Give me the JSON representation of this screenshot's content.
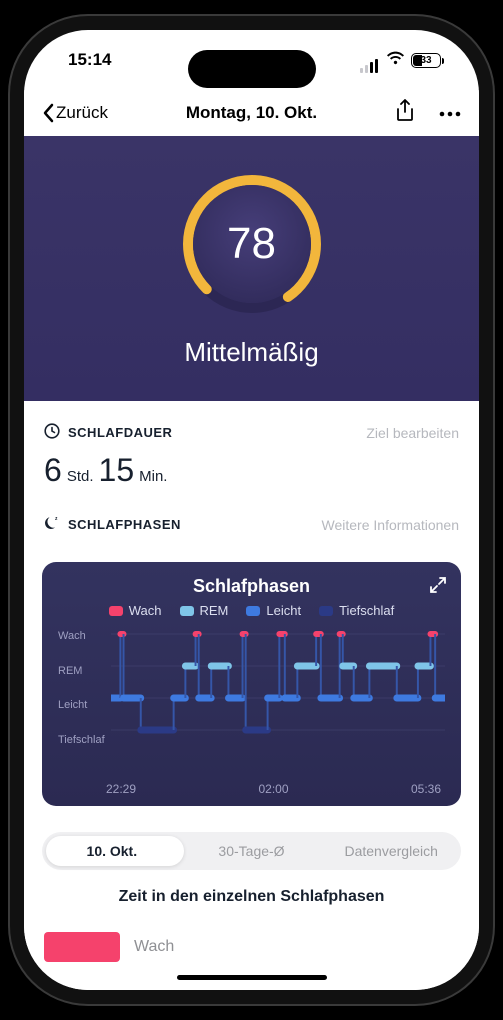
{
  "status": {
    "time": "15:14",
    "battery_pct": "33"
  },
  "nav": {
    "back": "Zurück",
    "title": "Montag, 10. Okt."
  },
  "score": {
    "value": "78",
    "rating": "Mittelmäßig",
    "pct": 78
  },
  "colors": {
    "ring": "#f2b63c",
    "wake": "#f5426c",
    "rem": "#7fc5e8",
    "light": "#3e7ae0",
    "deep": "#2b3a86"
  },
  "duration": {
    "section_title": "SCHLAFDAUER",
    "edit_goal": "Ziel bearbeiten",
    "hours": "6",
    "hours_unit": "Std.",
    "minutes": "15",
    "minutes_unit": "Min."
  },
  "phases": {
    "section_title": "SCHLAFPHASEN",
    "more_info": "Weitere Informationen",
    "chart_title": "Schlafphasen"
  },
  "chart_data": {
    "type": "line",
    "title": "Schlafphasen",
    "y_categories": [
      "Wach",
      "REM",
      "Leicht",
      "Tiefschlaf"
    ],
    "x_ticks": [
      "22:29",
      "02:00",
      "05:36"
    ],
    "x_range_minutes": [
      0,
      427
    ],
    "legend": [
      {
        "name": "Wach",
        "color": "#f5426c"
      },
      {
        "name": "REM",
        "color": "#7fc5e8"
      },
      {
        "name": "Leicht",
        "color": "#3e7ae0"
      },
      {
        "name": "Tiefschlaf",
        "color": "#2b3a86"
      }
    ],
    "segments": [
      {
        "stage": "Leicht",
        "start": 0,
        "end": 12
      },
      {
        "stage": "Wach",
        "start": 12,
        "end": 16
      },
      {
        "stage": "Leicht",
        "start": 16,
        "end": 38
      },
      {
        "stage": "Tiefschlaf",
        "start": 38,
        "end": 80
      },
      {
        "stage": "Leicht",
        "start": 80,
        "end": 95
      },
      {
        "stage": "REM",
        "start": 95,
        "end": 108
      },
      {
        "stage": "Wach",
        "start": 108,
        "end": 112
      },
      {
        "stage": "Leicht",
        "start": 112,
        "end": 128
      },
      {
        "stage": "REM",
        "start": 128,
        "end": 150
      },
      {
        "stage": "Leicht",
        "start": 150,
        "end": 168
      },
      {
        "stage": "Wach",
        "start": 168,
        "end": 172
      },
      {
        "stage": "Tiefschlaf",
        "start": 172,
        "end": 200
      },
      {
        "stage": "Leicht",
        "start": 200,
        "end": 215
      },
      {
        "stage": "Wach",
        "start": 215,
        "end": 222
      },
      {
        "stage": "Leicht",
        "start": 222,
        "end": 238
      },
      {
        "stage": "REM",
        "start": 238,
        "end": 262
      },
      {
        "stage": "Wach",
        "start": 262,
        "end": 268
      },
      {
        "stage": "Leicht",
        "start": 268,
        "end": 292
      },
      {
        "stage": "Wach",
        "start": 292,
        "end": 296
      },
      {
        "stage": "REM",
        "start": 296,
        "end": 310
      },
      {
        "stage": "Leicht",
        "start": 310,
        "end": 330
      },
      {
        "stage": "REM",
        "start": 330,
        "end": 365
      },
      {
        "stage": "Leicht",
        "start": 365,
        "end": 392
      },
      {
        "stage": "REM",
        "start": 392,
        "end": 408
      },
      {
        "stage": "Wach",
        "start": 408,
        "end": 414
      },
      {
        "stage": "Leicht",
        "start": 414,
        "end": 427
      }
    ]
  },
  "tabs": {
    "t0": "10. Okt.",
    "t1": "30-Tage-Ø",
    "t2": "Datenvergleich"
  },
  "time_heading": "Zeit in den einzelnen Schlafphasen",
  "stage_labels": {
    "wake": "Wach"
  }
}
